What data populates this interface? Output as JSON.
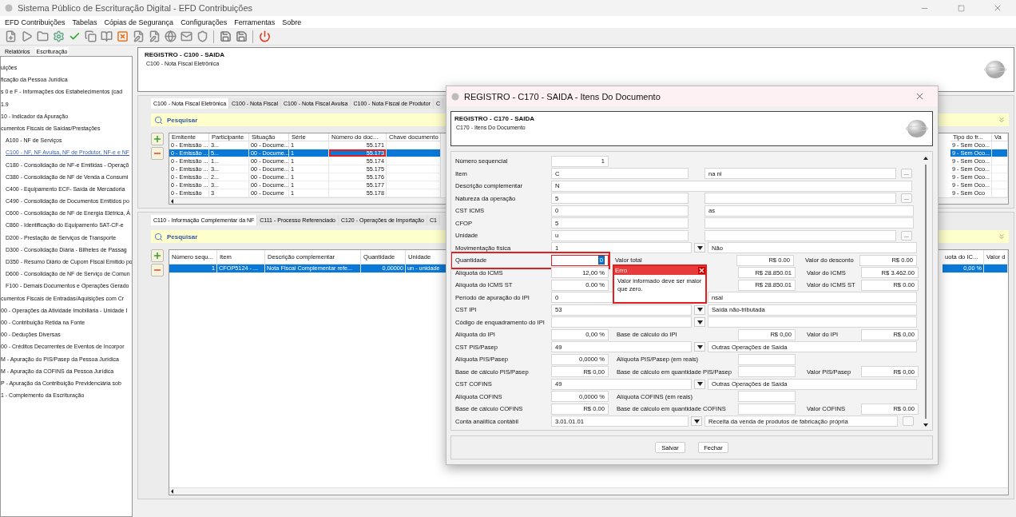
{
  "window": {
    "title": "Sistema Público de Escrituração Digital - EFD Contribuições"
  },
  "menu": [
    "EFD Contribuições",
    "Tabelas",
    "Cópias de Segurança",
    "Configurações",
    "Ferramentas",
    "Sobre"
  ],
  "side_tabs": [
    {
      "label": "Relatórios",
      "selected": false
    },
    {
      "label": "Escrituração",
      "selected": true
    }
  ],
  "tree": [
    {
      "label": "uições",
      "selected": false
    },
    {
      "label": "ficação da Pessoa Jurídica",
      "selected": false
    },
    {
      "label": "s 0 e F - Informações dos Estabelecimentos (cad",
      "selected": false
    },
    {
      "label": "1.9",
      "selected": false
    },
    {
      "label": "10 - Indicador da Apuração",
      "selected": false
    },
    {
      "label": "cumentos Fiscais de Saídas/Prestações",
      "selected": false,
      "children": [
        {
          "label": "A100 - NF de Serviços",
          "selected": false
        },
        {
          "label": "C100 - NF, NF Avulsa, NF de Produtor, NF-e e NF",
          "selected": true
        },
        {
          "label": "C180 - Consolidação de NF-e Emitidas - Operaçõ",
          "selected": false
        },
        {
          "label": "C380 - Consolidação de NF de Venda a Consumi",
          "selected": false
        },
        {
          "label": "C400 - Equipamento ECF- Saída de Mercadoria",
          "selected": false
        },
        {
          "label": "C490 - Consolidação de Documentos Emitidos po",
          "selected": false
        },
        {
          "label": "C600 - Consolidação de NF de Energia Elétrica, Á",
          "selected": false
        },
        {
          "label": "C860 - Identificação do Equipamento SAT-CF-e",
          "selected": false
        },
        {
          "label": "D200 - Prestação de Serviços de Transporte",
          "selected": false
        },
        {
          "label": "D300 - Consolidação Diária - Bilhetes de Passag",
          "selected": false
        },
        {
          "label": "D350 - Resumo Diário de Cupom Fiscal Emitido po",
          "selected": false
        },
        {
          "label": "D600 - Consolidação de NF de Serviço de Comun",
          "selected": false
        },
        {
          "label": "F100 - Demais Documentos e Operações Gerado",
          "selected": false
        }
      ]
    },
    {
      "label": "cumentos Fiscais de Entradas/Aquisições com Cr",
      "selected": false
    },
    {
      "label": "00 - Operações da Atividade Imobiliária - Unidade I",
      "selected": false
    },
    {
      "label": "00 - Contribuição Retida na Fonte",
      "selected": false
    },
    {
      "label": "00 - Deduções Diversas",
      "selected": false
    },
    {
      "label": "00 - Créditos Decorrentes de Eventos de Incorpor",
      "selected": false
    },
    {
      "label": "M - Apuração do PIS/Pasep da Pessoa Jurídica",
      "selected": false
    },
    {
      "label": "M - Apuração da COFINS da Pessoa Jurídica",
      "selected": false
    },
    {
      "label": "P - Apuração da Contribuição Previdenciária sob",
      "selected": false
    },
    {
      "label": "1 - Complemento da Escrituração",
      "selected": false
    }
  ],
  "register_header": {
    "title": "REGISTRO - C100 - SAIDA",
    "subtitle": "C100 - Nota Fiscal Eletrônica"
  },
  "upper_panel": {
    "tabs": [
      {
        "label": "C100 - Nota Fiscal Eletrônica",
        "selected": true
      },
      {
        "label": "C100 - Nota Fiscal",
        "selected": false
      },
      {
        "label": "C100 - Nota Fiscal Avulsa",
        "selected": false
      },
      {
        "label": "C100 - Nota Fiscal de Produtor",
        "selected": false
      },
      {
        "label": "C",
        "selected": false
      }
    ],
    "search": "Pesquisar",
    "columns": [
      "Emitente",
      "Participante",
      "Situação",
      "Série",
      "Número do doc...",
      "Chave documento",
      "Tipo do fr...",
      "Va"
    ],
    "rows": [
      {
        "selected": false,
        "annotated": false,
        "cells": [
          "0 - Emissão ...",
          "3...",
          "00 - Docume...",
          "1",
          "55.171",
          "9 - Sem Oco..."
        ]
      },
      {
        "selected": true,
        "annotated": true,
        "cells": [
          "0 - Emissão ...",
          "5...",
          "00 - Docume...",
          "1",
          "55.173",
          "9 - Sem Oco..."
        ]
      },
      {
        "selected": false,
        "annotated": false,
        "cells": [
          "0 - Emissão ...",
          "1...",
          "00 - Docume...",
          "1",
          "55.174",
          "9 - Sem Oco..."
        ]
      },
      {
        "selected": false,
        "annotated": false,
        "cells": [
          "0 - Emissão ...",
          "3...",
          "00 - Docume...",
          "1",
          "55.175",
          "9 - Sem Oco..."
        ]
      },
      {
        "selected": false,
        "annotated": false,
        "cells": [
          "0 - Emissão ...",
          "2...",
          "00 - Docume...",
          "1",
          "55.176",
          "9 - Sem Oco..."
        ]
      },
      {
        "selected": false,
        "annotated": false,
        "cells": [
          "0 - Emissão ...",
          "3...",
          "00 - Docume...",
          "1",
          "55.177",
          "9 - Sem Oco..."
        ]
      },
      {
        "selected": false,
        "annotated": false,
        "cells": [
          "0 - Emissão",
          "3",
          "00 - Docume",
          "1",
          "55.178",
          "9 - Sem Oco"
        ]
      }
    ]
  },
  "lower_panel": {
    "tabs": [
      {
        "label": "C110 - Informação Complementar da NF",
        "selected": true
      },
      {
        "label": "C111 - Processo Referenciado",
        "selected": false
      },
      {
        "label": "C120 - Operações de Importação",
        "selected": false
      },
      {
        "label": "C1",
        "selected": false
      }
    ],
    "search": "Pesquisar",
    "columns": [
      "Número sequ...",
      "Item",
      "Descrição complementar",
      "Quantidade",
      "Unidade",
      "uota do IC...",
      "Valor d"
    ],
    "rows": [
      {
        "selected": true,
        "cells": [
          "1",
          "CFOP5124 - ...",
          "Nota Fiscal Complementar refe...",
          "0,00000",
          "un - unidade",
          "0,00 %"
        ]
      }
    ]
  },
  "dialog": {
    "title": "REGISTRO - C170 - SAIDA - Itens Do Documento",
    "header": {
      "title": "REGISTRO - C170 - SAIDA",
      "subtitle": "C170 - Itens Do Documento"
    },
    "fields": [
      {
        "kind": "number",
        "label": "Número sequencial",
        "value": "1"
      },
      {
        "kind": "lookup",
        "label": "Item",
        "code": "C",
        "description": "na ni",
        "browse": "..."
      },
      {
        "kind": "text",
        "label": "Descrição complementar",
        "value": "N"
      },
      {
        "kind": "lookup",
        "label": "Natureza da operação",
        "code": "5",
        "browse": "..."
      },
      {
        "kind": "lookup",
        "label": "CST ICMS",
        "code": "0",
        "description": "as"
      },
      {
        "kind": "lookup",
        "label": "CFOP",
        "code": "5"
      },
      {
        "kind": "lookup",
        "label": "Unidade",
        "code": "u",
        "browse": "..."
      },
      {
        "kind": "select",
        "label": "Movimentação física",
        "code": "1",
        "description": "Não"
      },
      {
        "kind": "triple",
        "label": "Quantidade",
        "value": "0",
        "error": true,
        "annotated": true,
        "label2": "Valor total",
        "value2": "R$ 0.00",
        "label3": "Valor do desconto",
        "value3": "R$ 0.00"
      },
      {
        "kind": "triple",
        "label": "Alíquota do ICMS",
        "value": "12,00 %",
        "value2": "R$ 28.850.01",
        "label3": "Valor do ICMS",
        "value3": "R$ 3.462.00"
      },
      {
        "kind": "triple",
        "label": "Alíquota do ICMS ST",
        "value": "0.00 %",
        "value2": "R$ 28.850.01",
        "label3": "Valor do ICMS ST",
        "value3": "R$ 0.00"
      },
      {
        "kind": "select",
        "label": "Período de apuração do IPI",
        "code": "0",
        "description": "nsal"
      },
      {
        "kind": "select",
        "label": "CST IPI",
        "code": "53",
        "description": "Saída não-tributada"
      },
      {
        "kind": "select",
        "label": "Código de enquadramento do IPI"
      },
      {
        "kind": "triple",
        "label": "Alíquota do IPI",
        "value": "0,00 %",
        "label2": "Base de cálculo do IPI",
        "value2": "R$ 0,00",
        "label3": "Valor do IPI",
        "value3": "R$ 0,00"
      },
      {
        "kind": "select",
        "label": "CST PIS/Pasep",
        "code": "49",
        "description": "Outras Operações de Saída"
      },
      {
        "kind": "triple",
        "label": "Alíquota PIS/Pasep",
        "value": "0,0000 %",
        "label2": "Alíquota PIS/Pasep (em reais)"
      },
      {
        "kind": "triple",
        "label": "Base de cálculo PIS/Pasep",
        "value": "R$ 0,00",
        "label2": "Base de cálculo em quantidade PIS/Pasep",
        "label3": "Valor PIS/Pasep",
        "value3": "R$ 0,00"
      },
      {
        "kind": "select",
        "label": "CST COFINS",
        "code": "49",
        "description": "Outras Operações de Saída"
      },
      {
        "kind": "triple",
        "label": "Alíquota COFINS",
        "value": "0,0000 %",
        "label2": "Alíquota COFINS (em reais)"
      },
      {
        "kind": "triple",
        "label": "Base de cálculo COFINS",
        "value": "R$ 0.00",
        "label2": "Base de cálculo em quantidade COFINS",
        "label3": "Valor COFINS",
        "value3": "R$ 0.00"
      },
      {
        "kind": "select",
        "label": "Conta analítica contábil",
        "code": "3.01.01.01",
        "description": "Receita da venda de produtos de fabricação própria",
        "browse": true
      }
    ],
    "error_popup": {
      "title": "Erro",
      "message": "Valor informado deve ser maior que zero."
    },
    "buttons": [
      "Salvar",
      "Fechar"
    ]
  }
}
